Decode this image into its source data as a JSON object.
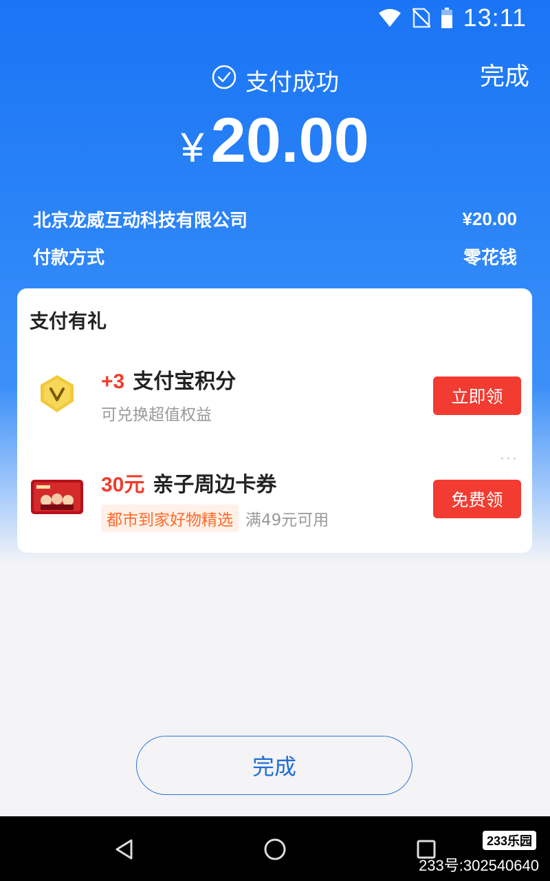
{
  "status_bar": {
    "time": "13:11"
  },
  "header": {
    "done_label": "完成",
    "success_text": "支付成功",
    "currency": "¥",
    "amount": "20.00"
  },
  "details": [
    {
      "label": "北京龙威互动科技有限公司",
      "value": "¥20.00"
    },
    {
      "label": "付款方式",
      "value": "零花钱"
    }
  ],
  "gift": {
    "title": "支付有礼",
    "items": [
      {
        "highlight": "+3",
        "title": "支付宝积分",
        "subtitle": "可兑换超值权益",
        "tag": "",
        "button": "立即领"
      },
      {
        "highlight": "30元",
        "title": "亲子周边卡券",
        "tag": "都市到家好物精选",
        "subtitle": "满49元可用",
        "button": "免费领"
      }
    ],
    "more": "···"
  },
  "footer": {
    "done_label": "完成"
  },
  "watermark": {
    "logo": "233乐园",
    "id": "233号:302540640"
  },
  "colors": {
    "primary_blue": "#1a74f5",
    "button_red": "#f23b31",
    "tag_orange": "#ff6a2a"
  }
}
